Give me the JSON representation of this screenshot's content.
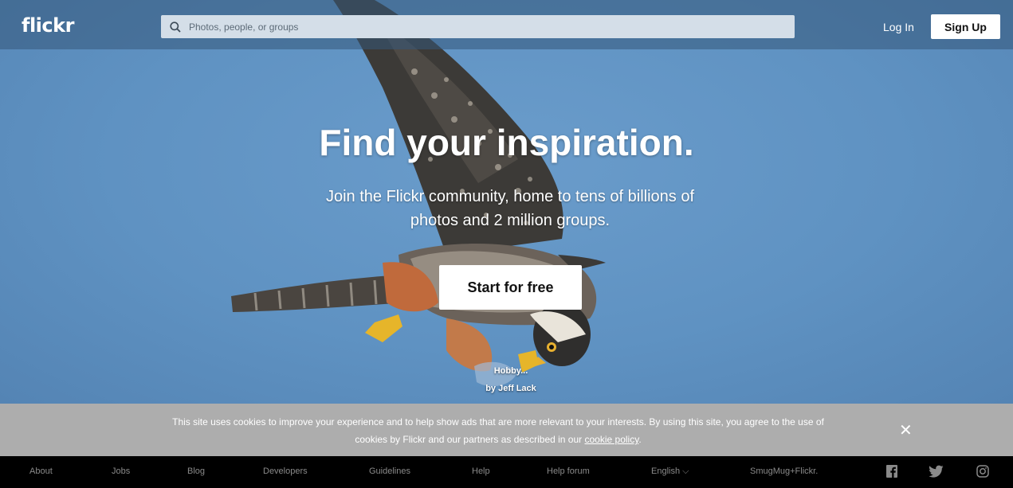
{
  "header": {
    "logo": "flickr",
    "search_placeholder": "Photos, people, or groups",
    "login_label": "Log In",
    "signup_label": "Sign Up"
  },
  "hero": {
    "headline": "Find your inspiration.",
    "subtitle_line1": "Join the Flickr community, home to tens of billions of",
    "subtitle_line2": "photos and 2 million groups.",
    "cta_label": "Start for free",
    "photo_title": "Hobby...",
    "photo_author": "by Jeff Lack"
  },
  "cookie_banner": {
    "text_line1": "This site uses cookies to improve your experience and to help show ads that are more relevant to your interests. By using this site, you agree to the use of",
    "text_line2_prefix": "cookies by Flickr and our partners as described in our",
    "link_label": "cookie policy",
    "text_line2_suffix": ".",
    "close_glyph": "✕"
  },
  "footer": {
    "links": [
      "About",
      "Jobs",
      "Blog",
      "Developers",
      "Guidelines",
      "Help",
      "Help forum",
      "English",
      "SmugMug+Flickr."
    ],
    "language_chevron": "⌵",
    "social_icons": [
      "facebook-icon",
      "twitter-icon",
      "instagram-icon"
    ]
  },
  "colors": {
    "sky": "#6095c5",
    "topbar": "#34587a",
    "cookie_bg": "#adadad",
    "footer_bg": "#000000",
    "footer_text": "#8a8a8a"
  }
}
